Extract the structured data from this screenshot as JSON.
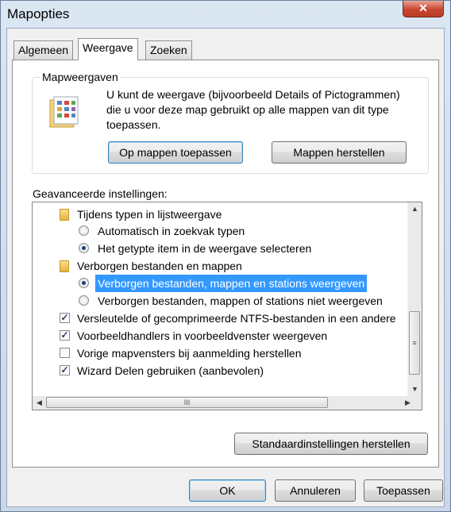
{
  "window": {
    "title": "Mapopties",
    "close_label": "✕"
  },
  "tabs": [
    {
      "label": "Algemeen"
    },
    {
      "label": "Weergave",
      "active": true
    },
    {
      "label": "Zoeken"
    }
  ],
  "folder_views": {
    "legend": "Mapweergaven",
    "description": "U kunt de weergave (bijvoorbeeld Details of Pictogrammen) die u voor deze map gebruikt op alle mappen van dit type toepassen.",
    "apply_button": "Op mappen toepassen",
    "reset_button": "Mappen herstellen"
  },
  "advanced": {
    "label": "Geavanceerde instellingen:",
    "items": [
      {
        "type": "folder",
        "label": "Tijdens typen in lijstweergave"
      },
      {
        "type": "radio",
        "checked": false,
        "label": "Automatisch in zoekvak typen"
      },
      {
        "type": "radio",
        "checked": true,
        "label": "Het getypte item in de weergave selecteren"
      },
      {
        "type": "folder",
        "label": "Verborgen bestanden en mappen"
      },
      {
        "type": "radio",
        "checked": true,
        "selected": true,
        "label": "Verborgen bestanden, mappen en stations weergeven"
      },
      {
        "type": "radio",
        "checked": false,
        "label": "Verborgen bestanden, mappen of stations niet weergeven"
      },
      {
        "type": "checkbox",
        "checked": true,
        "label": "Versleutelde of gecomprimeerde NTFS-bestanden in een andere"
      },
      {
        "type": "checkbox",
        "checked": true,
        "label": "Voorbeeldhandlers in voorbeeldvenster weergeven"
      },
      {
        "type": "checkbox",
        "checked": false,
        "label": "Vorige mapvensters bij aanmelding herstellen"
      },
      {
        "type": "checkbox",
        "checked": true,
        "label": "Wizard Delen gebruiken (aanbevolen)"
      }
    ],
    "restore_defaults_button": "Standaardinstellingen herstellen"
  },
  "footer": {
    "ok": "OK",
    "cancel": "Annuleren",
    "apply": "Toepassen"
  },
  "glyphs": {
    "check": "✓",
    "up": "▲",
    "down": "▼",
    "left": "◀",
    "right": "▶",
    "grip_v": "≡",
    "grip_h": "III"
  }
}
